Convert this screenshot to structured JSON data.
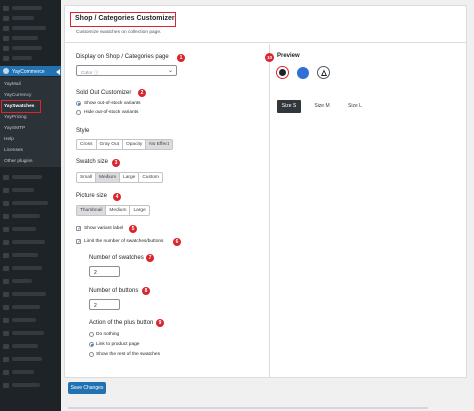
{
  "sidebar": {
    "active_menu": "YayCommerce",
    "submenu": [
      "YayMail",
      "YayCurrency",
      "YaySwatches",
      "YayPricing",
      "YaySMTP",
      "Help",
      "Licenses",
      "Other plugins"
    ]
  },
  "header": {
    "title": "Shop / Categories Customizer",
    "subtitle": "Customize swatches on collection page."
  },
  "display": {
    "label": "Display on Shop / Categories page",
    "select_value": "Color ⓘ",
    "badge": "1"
  },
  "sold_out": {
    "label": "Sold Out Customizer",
    "badge": "2",
    "options": [
      "Show out-of-stock variants",
      "Hide out-of-stock variants"
    ],
    "selected_index": 0
  },
  "style": {
    "label": "Style",
    "options": [
      "Cross",
      "Gray Out",
      "Opacity",
      "No Effect"
    ],
    "selected_index": 3
  },
  "swatch_size": {
    "label": "Swatch size",
    "badge": "3",
    "options": [
      "Small",
      "Medium",
      "Large",
      "Custom"
    ],
    "selected_index": 1
  },
  "picture_size": {
    "label": "Picture size",
    "badge": "4",
    "options": [
      "Thumbnail",
      "Medium",
      "Large"
    ],
    "selected_index": 0
  },
  "show_variant_label": {
    "label": "Show variant label",
    "checked": true,
    "badge": "5"
  },
  "limit_swatches": {
    "label": "Limit the number of swatches/buttons",
    "checked": true,
    "badge": "6"
  },
  "number_of_swatches": {
    "label": "Number of swatches",
    "value": "2",
    "badge": "7"
  },
  "number_of_buttons": {
    "label": "Number of buttons",
    "value": "2",
    "badge": "8"
  },
  "plus_action": {
    "label": "Action of the plus button",
    "badge": "9",
    "options": [
      "Do nothing",
      "Link to product page",
      "Show the rest of the swatches"
    ],
    "selected_index": 1
  },
  "preview": {
    "label": "Preview",
    "badge": "10",
    "swatch_colors": [
      "#1d2327",
      "#2f6fd6"
    ],
    "sizes": [
      "Size S",
      "Size M",
      "Size L"
    ],
    "selected_size": 0
  },
  "save_label": "Save Changes",
  "colors": {
    "accent": "#2271b1",
    "highlight": "#d9252b"
  }
}
